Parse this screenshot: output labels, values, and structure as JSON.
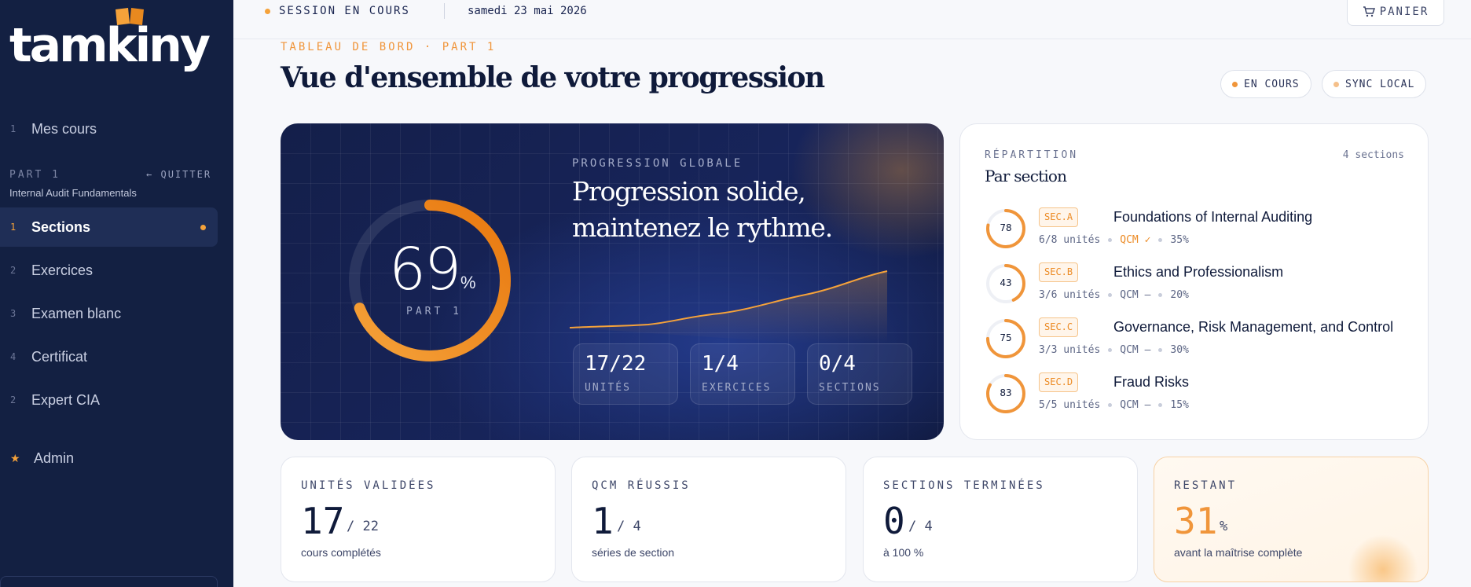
{
  "app": {
    "logo_text": "tamkiny"
  },
  "sidebar": {
    "top_item": {
      "num": "1",
      "label": "Mes cours"
    },
    "part_label": "PART 1",
    "quit_label": "QUITTER",
    "course_name": "Internal Audit Fundamentals",
    "items": [
      {
        "num": "1",
        "label": "Sections",
        "active": true
      },
      {
        "num": "2",
        "label": "Exercices"
      },
      {
        "num": "3",
        "label": "Examen blanc"
      },
      {
        "num": "4",
        "label": "Certificat"
      },
      {
        "num": "2",
        "label": "Expert CIA"
      }
    ],
    "admin_icon": "star-icon",
    "admin_label": "Admin"
  },
  "topbar": {
    "session_label": "SESSION EN COURS",
    "date": "samedi 23 mai 2026",
    "cart_label": "PANIER"
  },
  "header": {
    "eyebrow": "TABLEAU DE BORD · PART 1",
    "title": "Vue d'ensemble de votre progression",
    "pills": [
      {
        "label": "EN COURS",
        "color": "#f0953a"
      },
      {
        "label": "SYNC LOCAL",
        "color": "#f5c08a"
      }
    ]
  },
  "hero": {
    "progress_value": "69",
    "progress_percent": 69,
    "progress_unit": "%",
    "progress_label": "PART 1",
    "eyebrow": "PROGRESSION GLOBALE",
    "title": "Progression solide, maintenez le rythme.",
    "stats": [
      {
        "value": "17/22",
        "label": "UNITÉS"
      },
      {
        "value": "1/4",
        "label": "EXERCICES"
      },
      {
        "value": "0/4",
        "label": "SECTIONS"
      }
    ]
  },
  "sections": {
    "eyebrow": "RÉPARTITION",
    "count": "4 sections",
    "title": "Par section",
    "rows": [
      {
        "score": "78",
        "score_pct": 78,
        "tag": "SEC.A",
        "name": "Foundations of Internal Auditing",
        "units": "6/8 unités",
        "qcm": "QCM ✓",
        "qcm_ok": true,
        "weight": "35%"
      },
      {
        "score": "43",
        "score_pct": 43,
        "tag": "SEC.B",
        "name": "Ethics and Professionalism",
        "units": "3/6 unités",
        "qcm": "QCM —",
        "qcm_ok": false,
        "weight": "20%"
      },
      {
        "score": "75",
        "score_pct": 75,
        "tag": "SEC.C",
        "name": "Governance, Risk Management, and Control",
        "units": "3/3 unités",
        "qcm": "QCM —",
        "qcm_ok": false,
        "weight": "30%"
      },
      {
        "score": "83",
        "score_pct": 83,
        "tag": "SEC.D",
        "name": "Fraud Risks",
        "units": "5/5 unités",
        "qcm": "QCM —",
        "qcm_ok": false,
        "weight": "15%"
      }
    ]
  },
  "kpis": [
    {
      "label": "UNITÉS VALIDÉES",
      "value": "17",
      "sub": "/ 22",
      "note": "cours complétés"
    },
    {
      "label": "QCM RÉUSSIS",
      "value": "1",
      "sub": "/ 4",
      "note": "séries de section"
    },
    {
      "label": "SECTIONS TERMINÉES",
      "value": "0",
      "sub": "/ 4",
      "note": "à 100 %"
    },
    {
      "label": "RESTANT",
      "value": "31",
      "sub": "%",
      "note": "avant la maîtrise complète",
      "accent": true
    }
  ],
  "colors": {
    "accent": "#f0953a",
    "navy": "#132042",
    "text": "#0f1a3a"
  }
}
